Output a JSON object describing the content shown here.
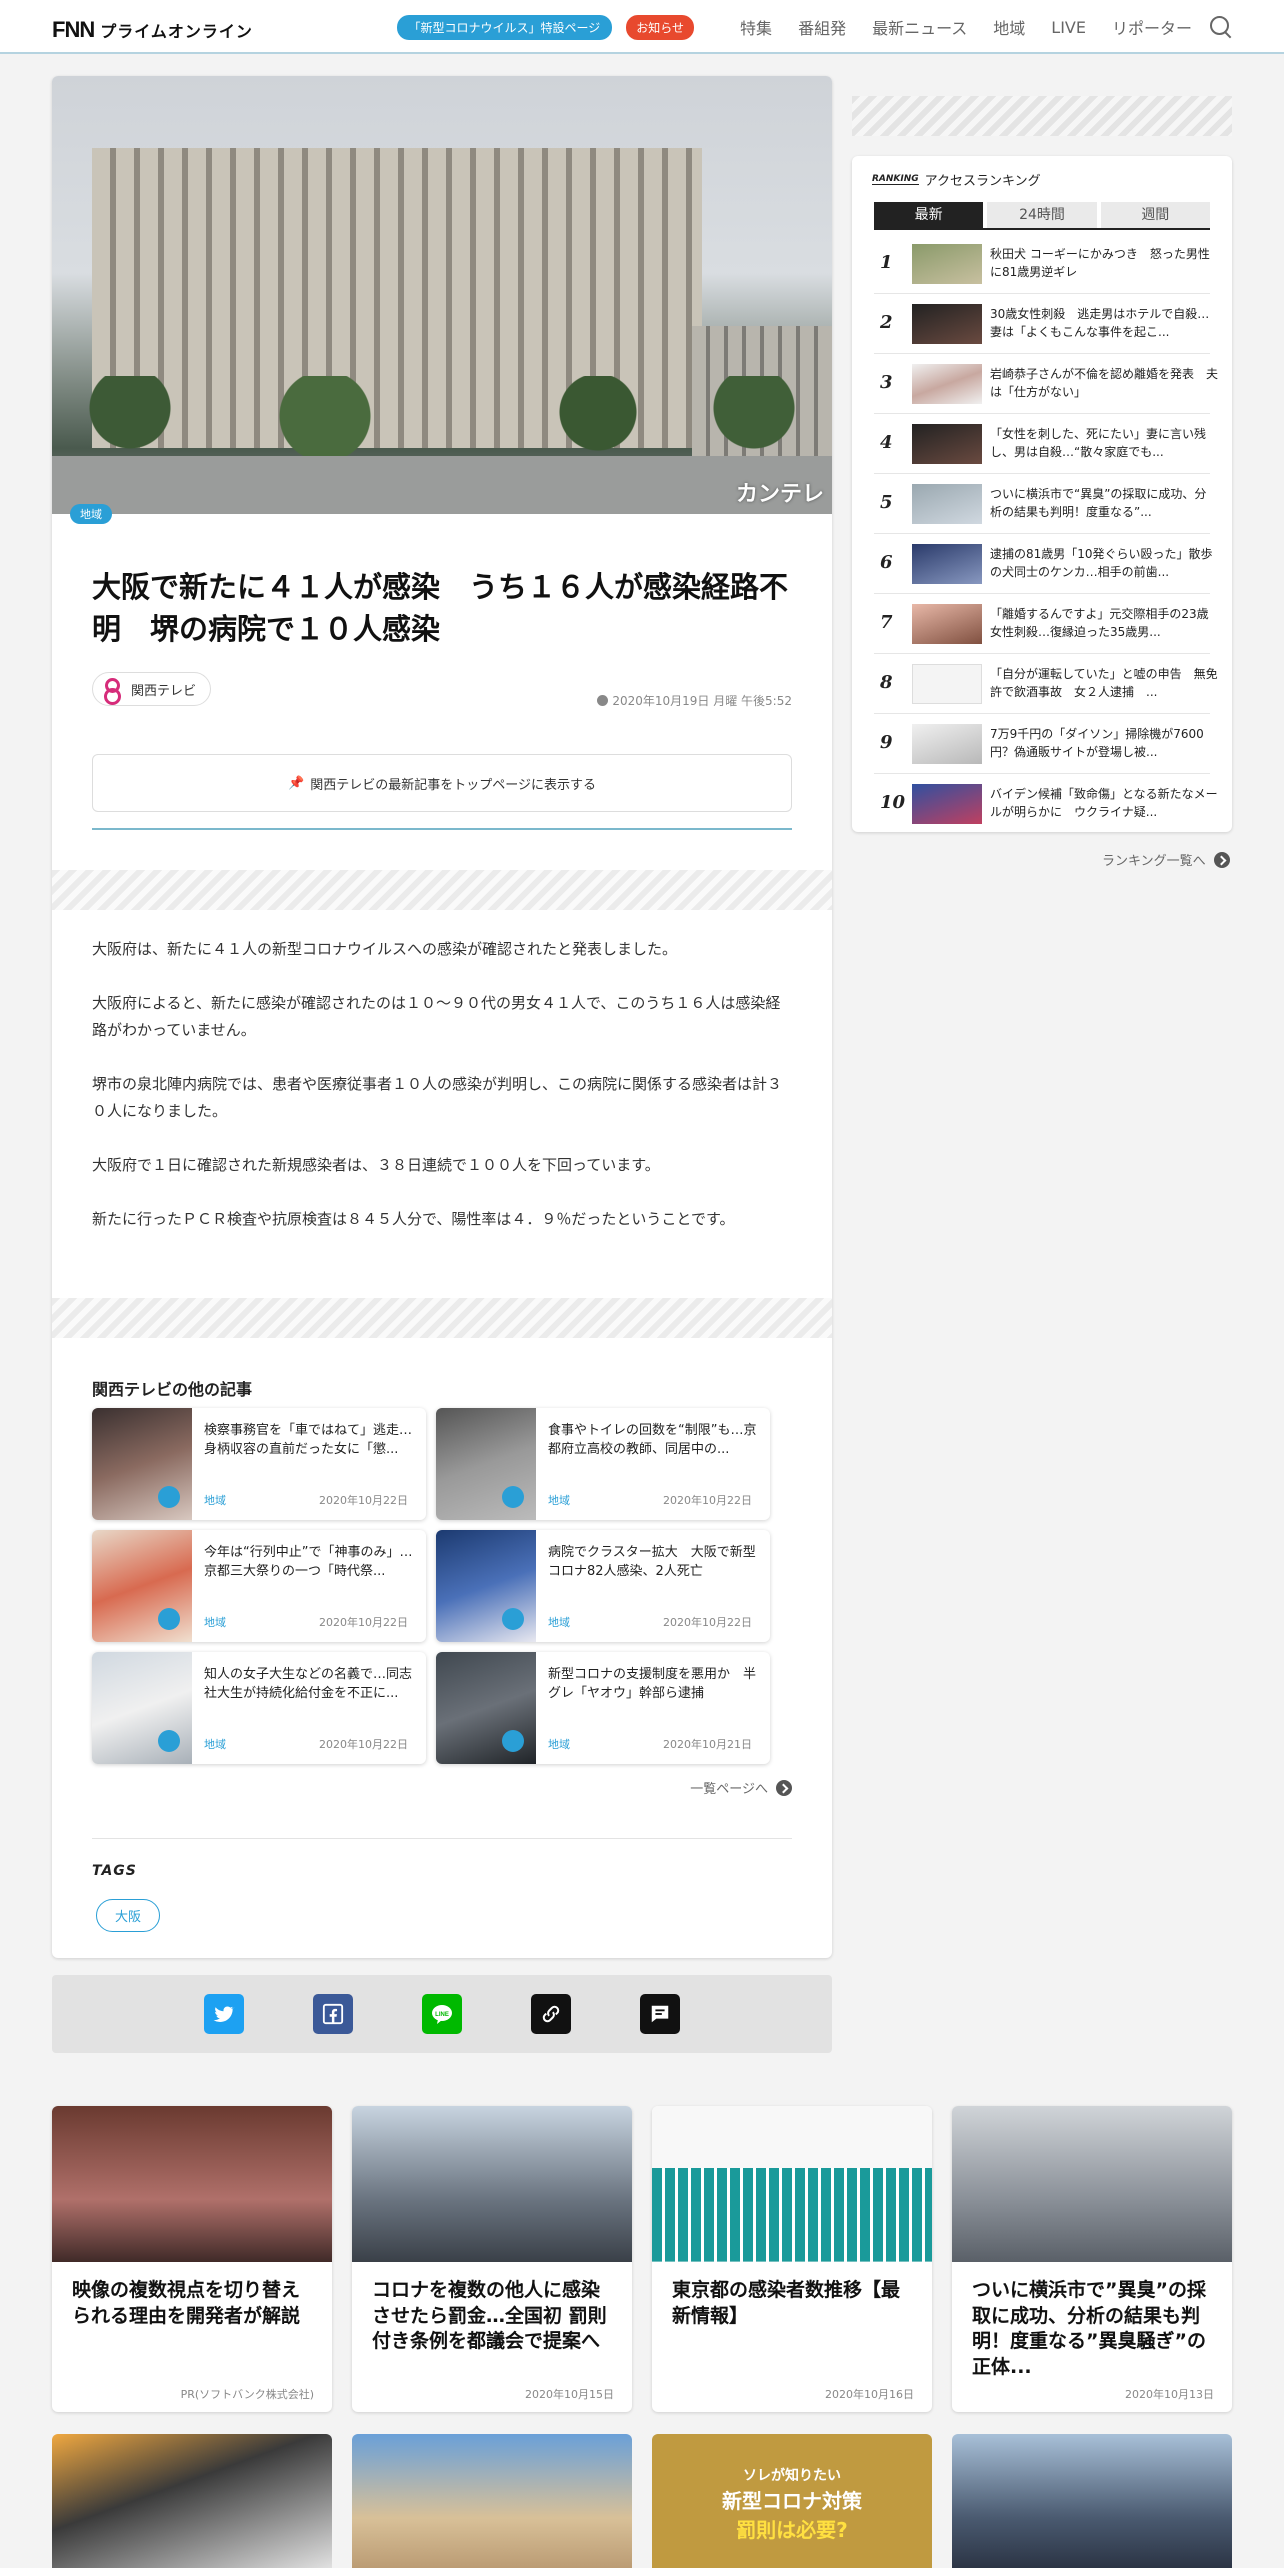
{
  "header": {
    "logo_fnn": "FNN",
    "logo_prime": "プライムオンライン",
    "corona_pill": "「新型コロナウイルス」特設ページ",
    "notice_pill": "お知らせ",
    "nav": [
      "特集",
      "番組発",
      "最新ニュース",
      "地域",
      "LIVE",
      "リポーター"
    ]
  },
  "article": {
    "image_watermark": "カンテレ",
    "category": "地域",
    "title": "大阪で新たに４１人が感染　うち１６人が感染経路不明　堺の病院で１０人感染",
    "source": "関西テレビ",
    "date": "2020年10月19日 月曜 午後5:52",
    "pin_button": "関西テレビの最新記事をトップページに表示する",
    "body": [
      "大阪府は、新たに４１人の新型コロナウイルスへの感染が確認されたと発表しました。",
      "大阪府によると、新たに感染が確認されたのは１０～９０代の男女４１人で、このうち１６人は感染経路がわかっていません。",
      "堺市の泉北陣内病院では、患者や医療従事者１０人の感染が判明し、この病院に関係する感染者は計３０人になりました。",
      "大阪府で１日に確認された新規感染者は、３８日連続で１００人を下回っています。",
      "新たに行ったＰＣＲ検査や抗原検査は８４５人分で、陽性率は４．９％だったということです。"
    ]
  },
  "other_articles": {
    "heading": "関西テレビの他の記事",
    "items": [
      {
        "title": "検察事務官を「車ではねて」逃走…身柄収容の直前だった女に「懲...",
        "tag": "地域",
        "date": "2020年10月22日"
      },
      {
        "title": "食事やトイレの回数を“制限”も…京都府立高校の教師、同居中の...",
        "tag": "地域",
        "date": "2020年10月22日"
      },
      {
        "title": "今年は“行列中止”で「神事のみ」…京都三大祭りの一つ「時代祭...",
        "tag": "地域",
        "date": "2020年10月22日"
      },
      {
        "title": "病院でクラスター拡大　大阪で新型コロナ82人感染、2人死亡",
        "tag": "地域",
        "date": "2020年10月22日"
      },
      {
        "title": "知人の女子大生などの名義で…同志社大生が持続化給付金を不正に...",
        "tag": "地域",
        "date": "2020年10月22日"
      },
      {
        "title": "新型コロナの支援制度を悪用か　半グレ「ヤオウ」幹部ら逮捕",
        "tag": "地域",
        "date": "2020年10月21日"
      }
    ],
    "more": "一覧ページへ"
  },
  "tags": {
    "heading": "TAGS",
    "items": [
      "大阪"
    ]
  },
  "ranking": {
    "label_en": "RANKING",
    "label_ja": "アクセスランキング",
    "tabs": [
      "最新",
      "24時間",
      "週間"
    ],
    "items": [
      {
        "num": "1",
        "text": "秋田犬 コーギーにかみつき　怒った男性に81歳男逆ギレ"
      },
      {
        "num": "2",
        "text": "30歳女性刺殺　逃走男はホテルで自殺…妻は「よくもこんな事件を起こ..."
      },
      {
        "num": "3",
        "text": "岩崎恭子さんが不倫を認め離婚を発表　夫は「仕方がない」"
      },
      {
        "num": "4",
        "text": "「女性を刺した、死にたい」妻に言い残し、男は自殺…“散々家庭でも..."
      },
      {
        "num": "5",
        "text": "ついに横浜市で“異臭”の採取に成功、分析の結果も判明！度重なる”..."
      },
      {
        "num": "6",
        "text": "逮捕の81歳男「10発ぐらい殴った」散歩の犬同士のケンカ…相手の前歯..."
      },
      {
        "num": "7",
        "text": "「離婚するんですよ」元交際相手の23歳女性刺殺…復縁迫った35歳男..."
      },
      {
        "num": "8",
        "text": "「自分が運転していた」と嘘の申告　無免許で飲酒事故　女２人逮捕　..."
      },
      {
        "num": "9",
        "text": "7万9千円の「ダイソン」掃除機が7600円？偽通販サイトが登場し被..."
      },
      {
        "num": "10",
        "text": "バイデン候補「致命傷」となる新たなメールが明らかに　ウクライナ疑..."
      }
    ],
    "more": "ランキング一覧へ"
  },
  "bottom_cards": [
    {
      "title": "映像の複数視点を切り替えられる理由を開発者が解説",
      "date": "PR(ソフトバンク株式会社)"
    },
    {
      "title": "コロナを複数の他人に感染させたら罰金…全国初 罰則付き条例を都議会で提案へ",
      "date": "2020年10月15日"
    },
    {
      "title": "東京都の感染者数推移【最新情報】",
      "date": "2020年10月16日"
    },
    {
      "title": "ついに横浜市で”異臭”の採取に成功、分析の結果も判明！度重なる”異臭騒ぎ”の正体...",
      "date": "2020年10月13日"
    }
  ],
  "bottom_thumb_texts": {
    "card3_banner_top": "ソレが知りたい",
    "card3_banner_mid": "新型コロナ対策",
    "card3_banner_bot": "罰則は必要?"
  },
  "colors": {
    "accent": "#2a9fd6",
    "notice": "#e8492e",
    "brand_kantele": "#d62c7a"
  }
}
